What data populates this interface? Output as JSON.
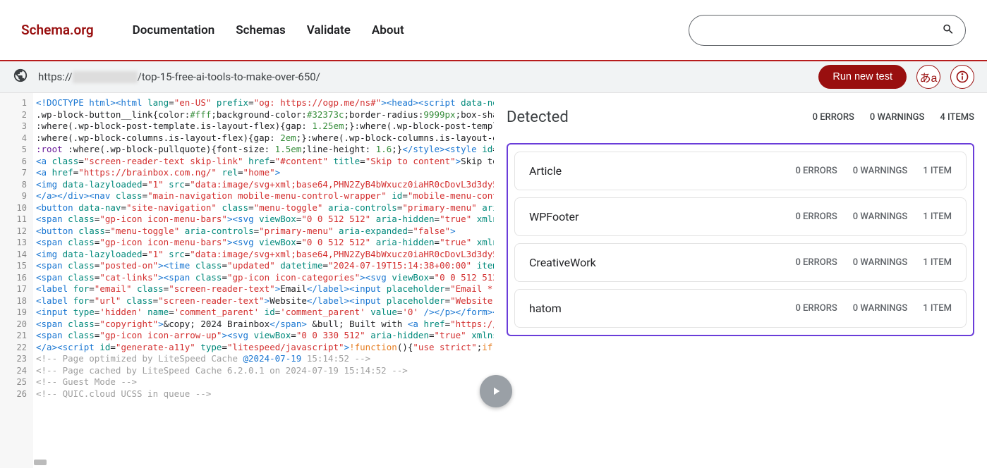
{
  "header": {
    "brand": "Schema.org",
    "nav": [
      "Documentation",
      "Schemas",
      "Validate",
      "About"
    ],
    "search_placeholder": ""
  },
  "url_bar": {
    "url_prefix": "https://",
    "url_suffix": "/top-15-free-ai-tools-to-make-over-650/",
    "run_label": "Run new test",
    "lang_label": "あa"
  },
  "code": {
    "lines": 26,
    "comments": {
      "l23": "<!-- Page optimized by LiteSpeed Cache @2024-07-19 15:14:52 -->",
      "l24": "<!-- Page cached by LiteSpeed Cache 6.2.0.1 on 2024-07-19 15:14:52 -->",
      "l25": "<!-- Guest Mode -->",
      "l26": "<!-- QUIC.cloud UCSS in queue -->"
    }
  },
  "results": {
    "title": "Detected",
    "summary": {
      "errors": "0 ERRORS",
      "warnings": "0 WARNINGS",
      "items": "4 ITEMS"
    },
    "rows": [
      {
        "name": "Article",
        "errors": "0 ERRORS",
        "warnings": "0 WARNINGS",
        "items": "1 ITEM"
      },
      {
        "name": "WPFooter",
        "errors": "0 ERRORS",
        "warnings": "0 WARNINGS",
        "items": "1 ITEM"
      },
      {
        "name": "CreativeWork",
        "errors": "0 ERRORS",
        "warnings": "0 WARNINGS",
        "items": "1 ITEM"
      },
      {
        "name": "hatom",
        "errors": "0 ERRORS",
        "warnings": "0 WARNINGS",
        "items": "1 ITEM"
      }
    ]
  }
}
